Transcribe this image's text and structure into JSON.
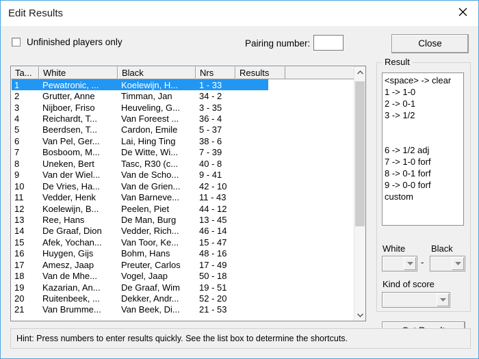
{
  "window": {
    "title": "Edit Results",
    "close_icon": "close-icon"
  },
  "toolbar": {
    "unfinished_label": "Unfinished players only",
    "unfinished_checked": false,
    "pairing_label": "Pairing number:",
    "pairing_value": "",
    "pairing_placeholder": "",
    "close_label": "Close"
  },
  "list": {
    "columns": [
      "Ta...",
      "White",
      "Black",
      "Nrs",
      "Results"
    ],
    "selected_index": 0,
    "rows": [
      {
        "table": "1",
        "white": "Pewatronic, ...",
        "black": "Koelewijn, H...",
        "nrs": "1 - 33",
        "results": ""
      },
      {
        "table": "2",
        "white": "Grutter, Anne",
        "black": "Timman, Jan",
        "nrs": "34 - 2",
        "results": ""
      },
      {
        "table": "3",
        "white": "Nijboer, Friso",
        "black": "Heuveling, G...",
        "nrs": "3 - 35",
        "results": ""
      },
      {
        "table": "4",
        "white": "Reichardt, T...",
        "black": "Van Foreest ...",
        "nrs": "36 - 4",
        "results": ""
      },
      {
        "table": "5",
        "white": "Beerdsen, T...",
        "black": "Cardon, Emile",
        "nrs": "5 - 37",
        "results": ""
      },
      {
        "table": "6",
        "white": "Van Pel, Ger...",
        "black": "Lai, Hing Ting",
        "nrs": "38 - 6",
        "results": ""
      },
      {
        "table": "7",
        "white": "Bosboom, M...",
        "black": "De Witte, Wi...",
        "nrs": "7 - 39",
        "results": ""
      },
      {
        "table": "8",
        "white": "Uneken, Bert",
        "black": "Tasc, R30 (c...",
        "nrs": "40 - 8",
        "results": ""
      },
      {
        "table": "9",
        "white": "Van der Wiel...",
        "black": "Van de Scho...",
        "nrs": "9 - 41",
        "results": ""
      },
      {
        "table": "10",
        "white": "De Vries, Ha...",
        "black": "Van de Grien...",
        "nrs": "42 - 10",
        "results": ""
      },
      {
        "table": "11",
        "white": "Vedder, Henk",
        "black": "Van Barneve...",
        "nrs": "11 - 43",
        "results": ""
      },
      {
        "table": "12",
        "white": "Koelewijn, B...",
        "black": "Peelen, Piet",
        "nrs": "44 - 12",
        "results": ""
      },
      {
        "table": "13",
        "white": "Ree, Hans",
        "black": "De Man, Burg",
        "nrs": "13 - 45",
        "results": ""
      },
      {
        "table": "14",
        "white": "De Graaf, Dion",
        "black": "Vedder, Rich...",
        "nrs": "46 - 14",
        "results": ""
      },
      {
        "table": "15",
        "white": "Afek, Yochan...",
        "black": "Van Toor, Ke...",
        "nrs": "15 - 47",
        "results": ""
      },
      {
        "table": "16",
        "white": "Huygen, Gijs",
        "black": "Bohm, Hans",
        "nrs": "48 - 16",
        "results": ""
      },
      {
        "table": "17",
        "white": "Amesz, Jaap",
        "black": "Preuter, Carlos",
        "nrs": "17 - 49",
        "results": ""
      },
      {
        "table": "18",
        "white": "Van de Mhe...",
        "black": "Vogel, Jaap",
        "nrs": "50 - 18",
        "results": ""
      },
      {
        "table": "19",
        "white": "Kazarian, An...",
        "black": "De Graaf, Wim",
        "nrs": "19 - 51",
        "results": ""
      },
      {
        "table": "20",
        "white": "Ruitenbeek, ...",
        "black": "Dekker, Andr...",
        "nrs": "52 - 20",
        "results": ""
      },
      {
        "table": "21",
        "white": "Van Brumme...",
        "black": "Van Beek, Di...",
        "nrs": "21 - 53",
        "results": ""
      }
    ]
  },
  "result_panel": {
    "legend": "Result",
    "shortcuts": [
      "<space> -> clear",
      "1 -> 1-0",
      "2 -> 0-1",
      "3 -> 1/2",
      "",
      "",
      "6 -> 1/2 adj",
      "7 -> 1-0 forf",
      "8 -> 0-1 forf",
      "9 -> 0-0 forf",
      "custom"
    ],
    "white_label": "White",
    "black_label": "Black",
    "separator": "-",
    "white_value": "",
    "black_value": "",
    "kind_of_score_label": "Kind of score",
    "kind_of_score_value": "",
    "set_result_label": "Set Result"
  },
  "statusbar": {
    "hint": "Hint: Press numbers to enter results quickly. See the list box to determine the shortcuts."
  },
  "colors": {
    "accent_border": "#4aa3df",
    "selection": "#2196f3",
    "dialog_bg": "#f0f0f0"
  }
}
